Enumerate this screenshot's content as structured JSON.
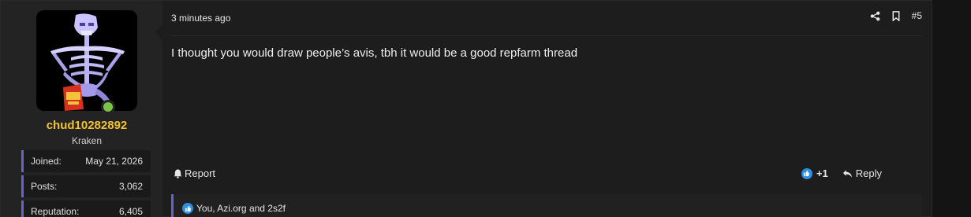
{
  "user": {
    "name": "chud10282892",
    "title": "Kraken",
    "stats": [
      {
        "label": "Joined:",
        "value": "May 21, 2026"
      },
      {
        "label": "Posts:",
        "value": "3,062"
      },
      {
        "label": "Reputation:",
        "value": "6,405"
      }
    ]
  },
  "post": {
    "time": "3 minutes ago",
    "number": "#5",
    "content": "I thought you would draw people’s avis, tbh it would be a good repfarm thread",
    "report_label": "Report",
    "score": "+1",
    "reply_label": "Reply",
    "reactions_text": "You, Azi.org and 2s2f"
  },
  "colors": {
    "accent": "#6a63c9",
    "username": "#f1c232",
    "online": "#7cc242",
    "like": "#2f8ee0"
  },
  "icons": [
    "share-icon",
    "bookmark-icon",
    "report-icon",
    "like-icon",
    "reply-icon"
  ]
}
